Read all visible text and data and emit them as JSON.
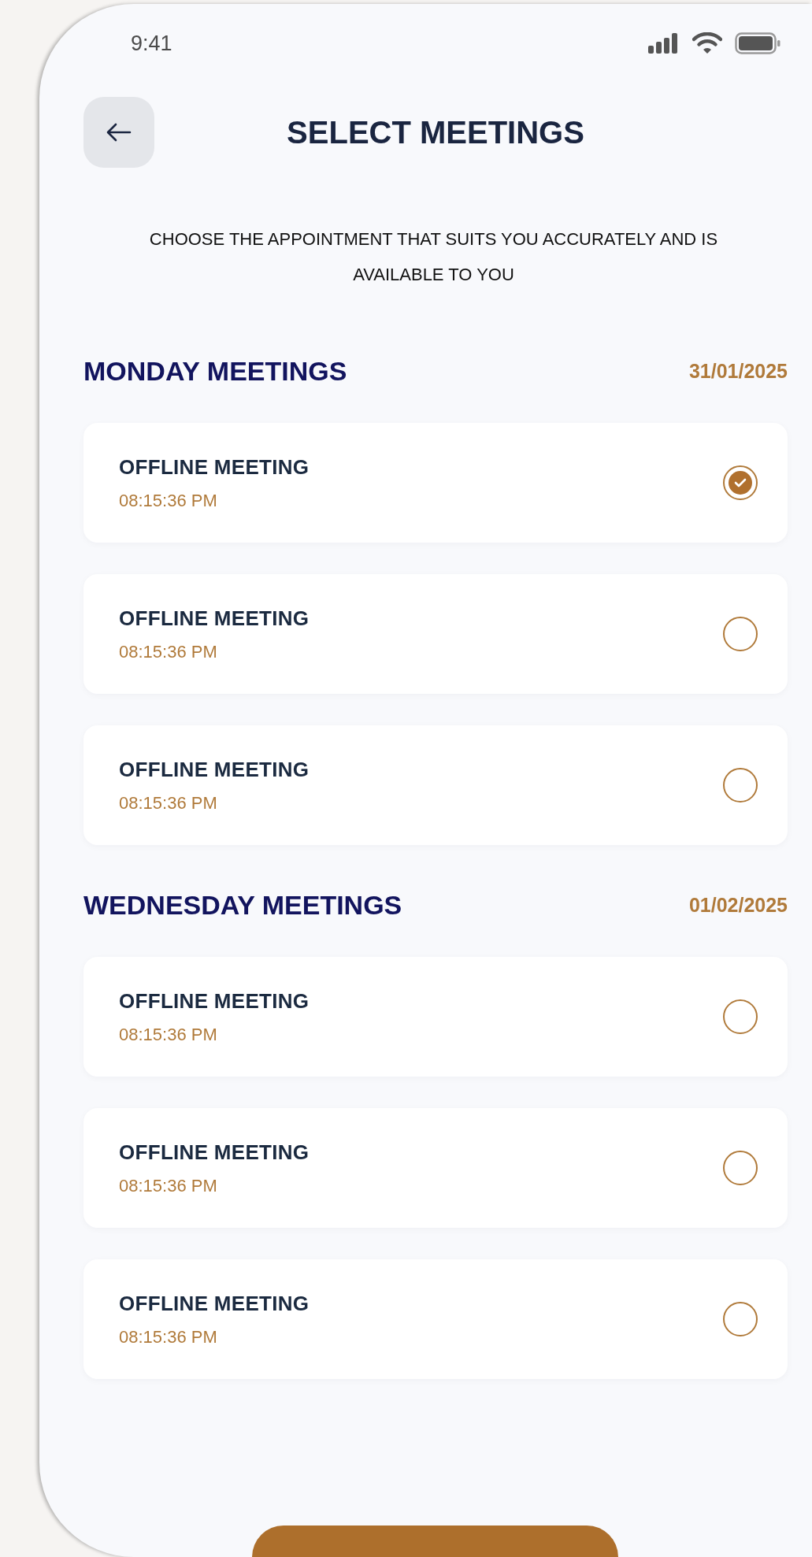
{
  "status_bar": {
    "time": "9:41"
  },
  "header": {
    "title": "SELECT MEETINGS"
  },
  "instructions": "CHOOSE THE APPOINTMENT THAT SUITS YOU ACCURATELY AND IS AVAILABLE TO YOU",
  "sections": [
    {
      "title": "MONDAY MEETINGS",
      "date": "31/01/2025",
      "meetings": [
        {
          "title": "OFFLINE MEETING",
          "time": "08:15:36 PM",
          "selected": true
        },
        {
          "title": "OFFLINE MEETING",
          "time": "08:15:36 PM",
          "selected": false
        },
        {
          "title": "OFFLINE MEETING",
          "time": "08:15:36 PM",
          "selected": false
        }
      ]
    },
    {
      "title": "WEDNESDAY MEETINGS",
      "date": "01/02/2025",
      "meetings": [
        {
          "title": "OFFLINE MEETING",
          "time": "08:15:36 PM",
          "selected": false
        },
        {
          "title": "OFFLINE MEETING",
          "time": "08:15:36 PM",
          "selected": false
        },
        {
          "title": "OFFLINE MEETING",
          "time": "08:15:36 PM",
          "selected": false
        }
      ]
    }
  ]
}
